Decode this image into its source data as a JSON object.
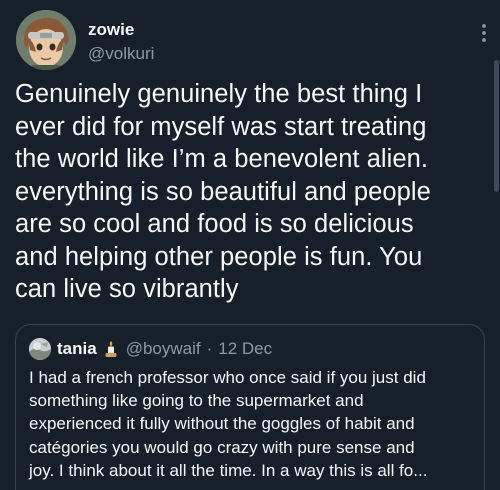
{
  "author": {
    "name": "zowie",
    "handle": "@volkuri"
  },
  "tweet": {
    "text": "Genuinely genuinely the best thing I\never did for myself was start treating\nthe world like I’m a benevolent alien.\neverything is so beautiful and people\nare so cool and food is so delicious\nand helping other people is fun. You\ncan live so vibrantly"
  },
  "quote": {
    "name": "tania",
    "handle": "@boywaif",
    "separator": "·",
    "date": "12 Dec",
    "text": "I had a french professor who once said if you just did\nsomething like going to the supermarket and\nexperienced it fully without the goggles of habit and\ncatégories you would go crazy with pure sense and\njoy. I think about it all the time. In a way this is all fo..."
  },
  "icons": {
    "more": "more-vertical-icon",
    "quote_emoji": "candle-emoji-icon"
  },
  "colors": {
    "background": "#15202b",
    "text_primary": "#f7f9f9",
    "text_secondary": "#8b98a5",
    "border": "#38444d"
  }
}
